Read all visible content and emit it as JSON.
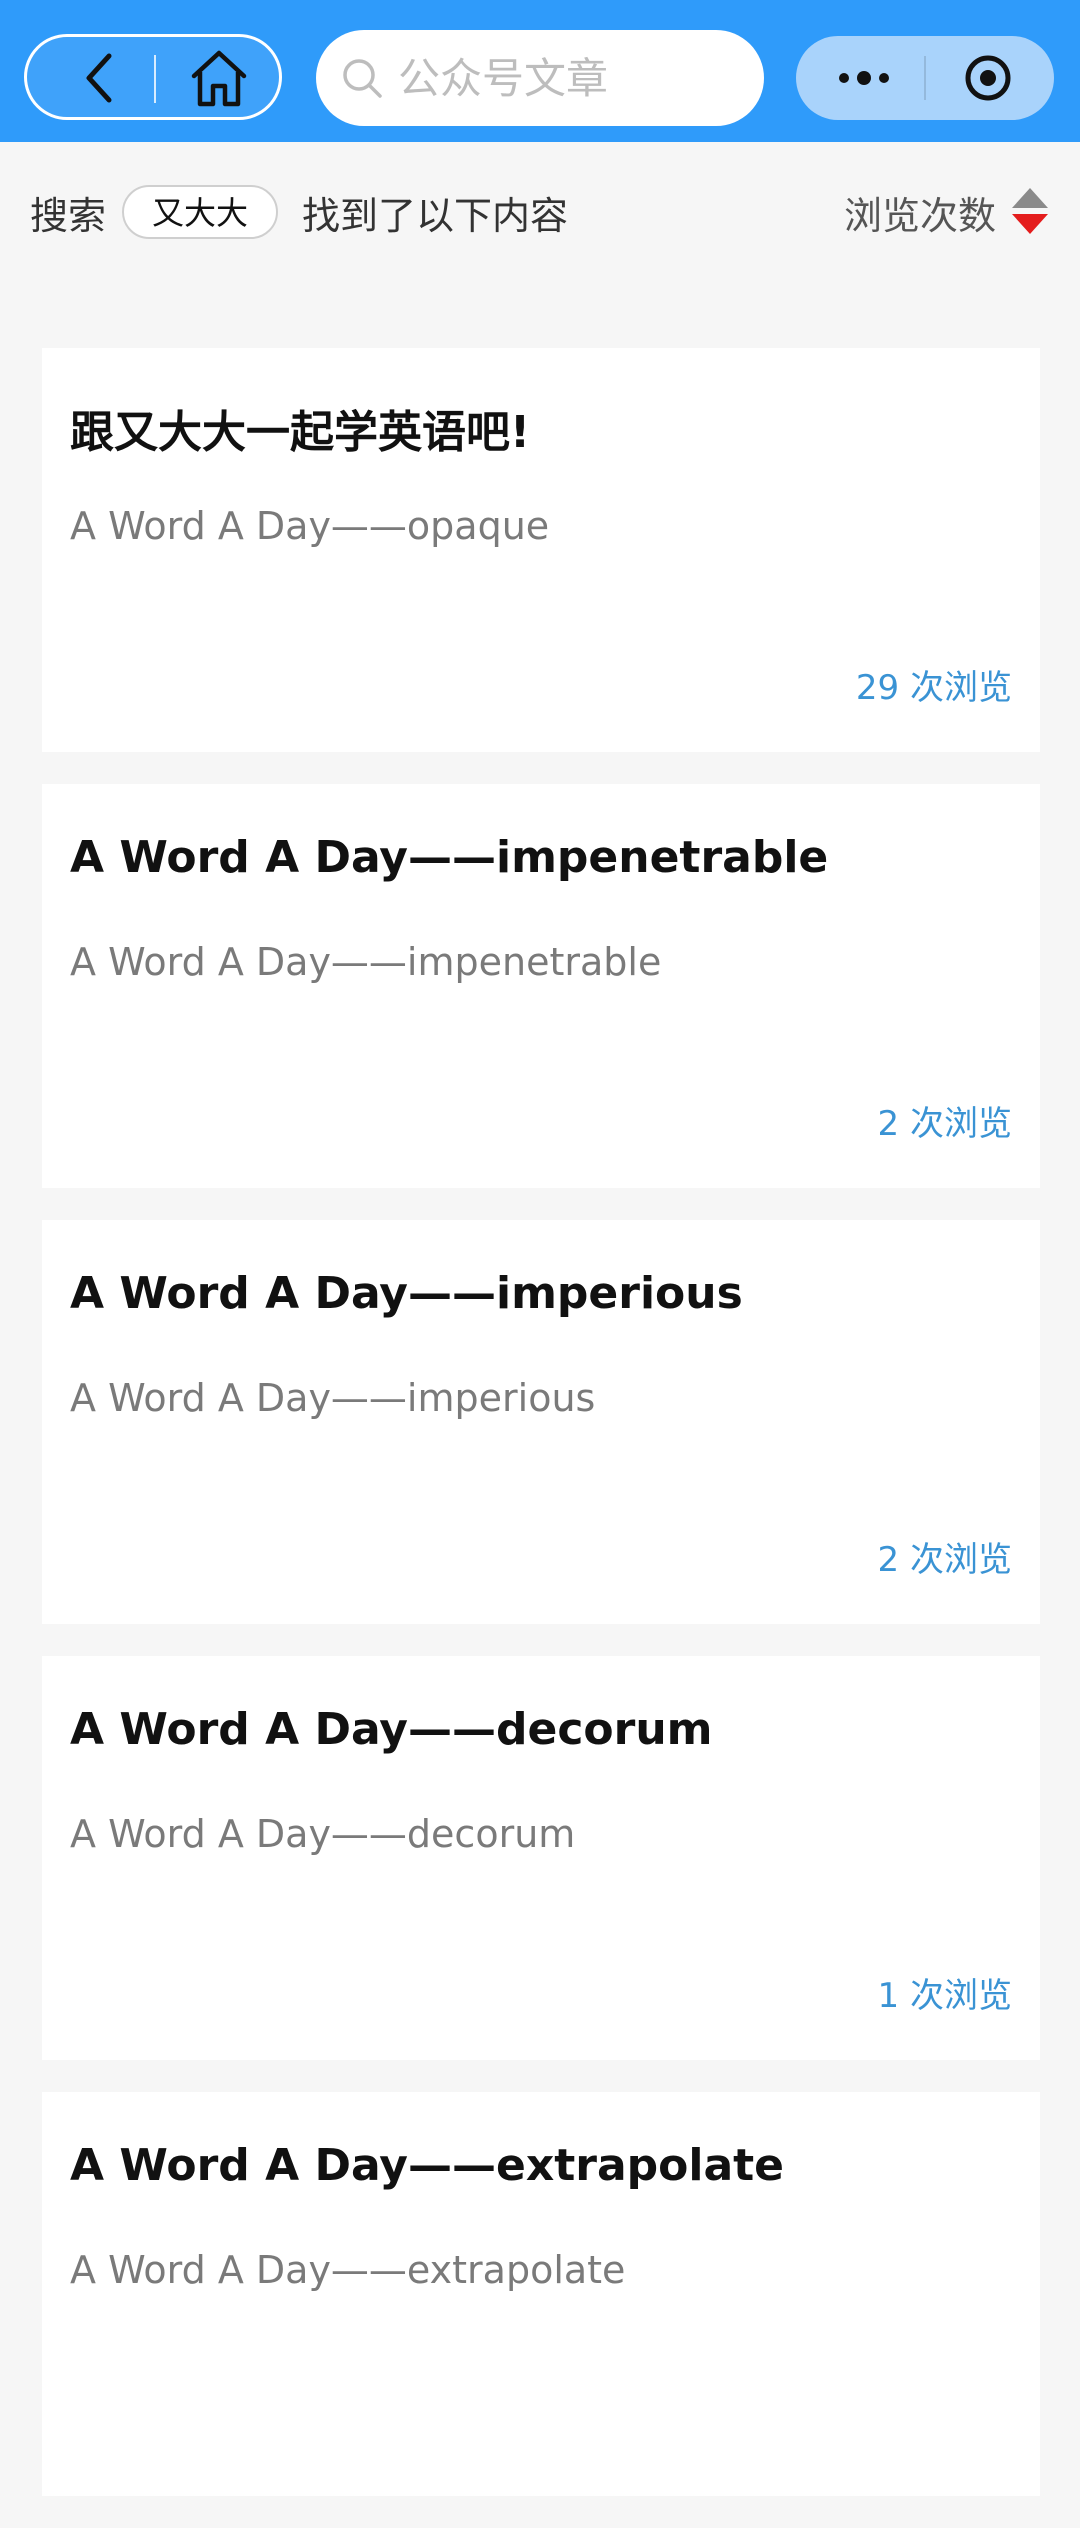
{
  "header": {
    "search_placeholder": "公众号文章"
  },
  "result_bar": {
    "prefix": "搜索",
    "keyword": "又大大",
    "suffix": "找到了以下内容",
    "sort_label": "浏览次数"
  },
  "articles": [
    {
      "title": "跟又大大一起学英语吧!",
      "subtitle": "A Word A Day——opaque",
      "views": "29 次浏览"
    },
    {
      "title": "A Word A Day——impenetrable",
      "subtitle": "A Word A Day——impenetrable",
      "views": "2 次浏览"
    },
    {
      "title": "A Word A Day——imperious",
      "subtitle": "A Word A Day——imperious",
      "views": "2 次浏览"
    },
    {
      "title": "A Word A Day——decorum",
      "subtitle": "A Word A Day——decorum",
      "views": "1 次浏览"
    },
    {
      "title": "A Word A Day——extrapolate",
      "subtitle": "A Word A Day——extrapolate",
      "views": ""
    }
  ],
  "colors": {
    "topbar": "#2f9bfa",
    "views_text": "#3a93d4",
    "sort_active": "#e41d1d"
  },
  "icons": {
    "back": "chevron-left-icon",
    "home": "home-icon",
    "search": "search-icon",
    "more": "more-dots-icon",
    "close": "target-circle-icon"
  }
}
